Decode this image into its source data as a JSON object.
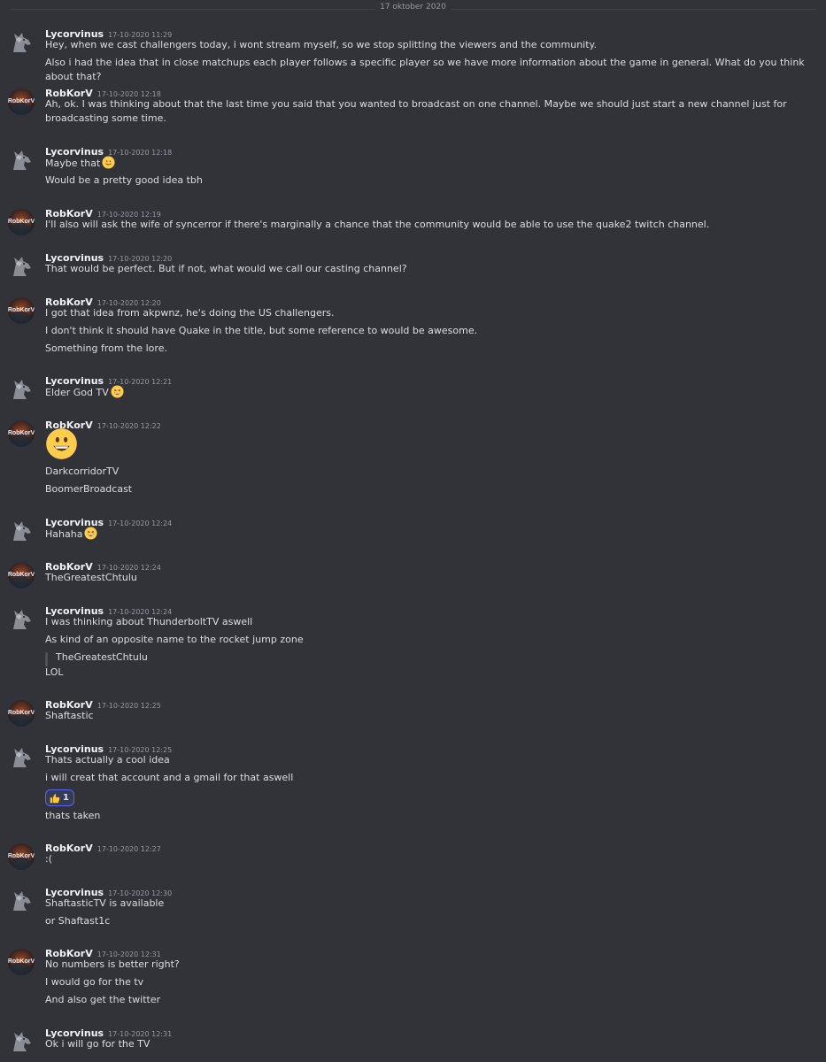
{
  "divider": {
    "date": "17 oktober 2020"
  },
  "users": {
    "lyc": {
      "name": "Lycorvinus"
    },
    "rob": {
      "name": "RobKorV",
      "avatar_text": "RobKorV"
    }
  },
  "groups": [
    {
      "author": "Lycorvinus",
      "time": "17-10-2020 11:29",
      "lines": [
        "Hey, when we cast challengers today, i wont stream myself, so we stop splitting the viewers and the community.",
        "Also i had the idea that in close matchups each player follows a specific player so we have more information about the game in general. What do you think about that?"
      ]
    },
    {
      "author": "RobKorV",
      "time": "17-10-2020 12:18",
      "lines": [
        "Ah, ok. I was thinking about that the last time you said that you wanted to broadcast on one channel. Maybe we should just start a new channel just for broadcasting some time."
      ]
    },
    {
      "author": "Lycorvinus",
      "time": "17-10-2020 12:18",
      "lines": [
        "Maybe that",
        "Would be a pretty good idea tbh"
      ],
      "emoji": "slightly-smiling-face"
    },
    {
      "author": "RobKorV",
      "time": "17-10-2020 12:19",
      "lines": [
        "I'll also will ask the wife of syncerror if there's marginally a chance that the community would be able to use the quake2 twitch channel."
      ]
    },
    {
      "author": "Lycorvinus",
      "time": "17-10-2020 12:20",
      "lines": [
        "That would be perfect. But if not, what would we call our casting channel?"
      ]
    },
    {
      "author": "RobKorV",
      "time": "17-10-2020 12:20",
      "lines": [
        "I got that idea from akpwnz, he's doing the US challengers.",
        "I don't think it should have Quake in the title, but some reference to would be awesome.",
        "Something from the lore."
      ]
    },
    {
      "author": "Lycorvinus",
      "time": "17-10-2020 12:21",
      "lines": [
        "Elder God TV"
      ],
      "emoji": "grinning-squinting-face"
    },
    {
      "author": "RobKorV",
      "time": "17-10-2020 12:22",
      "lines": [
        "DarkcorridorTV",
        "BoomerBroadcast"
      ],
      "big_emoji": "grinning-face"
    },
    {
      "author": "Lycorvinus",
      "time": "17-10-2020 12:24",
      "lines": [
        "Hahaha"
      ],
      "emoji": "grinning-squinting-face"
    },
    {
      "author": "RobKorV",
      "time": "17-10-2020 12:24",
      "lines": [
        "TheGreatestChtulu"
      ]
    },
    {
      "author": "Lycorvinus",
      "time": "17-10-2020 12:24",
      "lines": [
        "I was thinking about ThunderboltTV aswell",
        "As kind of an opposite name to the rocket jump zone"
      ],
      "quote": "TheGreatestChtulu",
      "after_quote": "LOL"
    },
    {
      "author": "RobKorV",
      "time": "17-10-2020 12:25",
      "lines": [
        "Shaftastic"
      ]
    },
    {
      "author": "Lycorvinus",
      "time": "17-10-2020 12:25",
      "lines": [
        "Thats actually a cool idea",
        "i will creat that account and a gmail for that aswell"
      ],
      "reaction": {
        "icon": "thumbs-up",
        "count": "1"
      },
      "after_reaction": "thats taken"
    },
    {
      "author": "RobKorV",
      "time": "17-10-2020 12:27",
      "lines": [
        ":("
      ]
    },
    {
      "author": "Lycorvinus",
      "time": "17-10-2020 12:30",
      "lines": [
        "ShaftasticTV is available",
        "or Shaftast1c"
      ]
    },
    {
      "author": "RobKorV",
      "time": "17-10-2020 12:31",
      "lines": [
        "No numbers is better right?",
        "I would go for the tv",
        "And also get the twitter"
      ]
    },
    {
      "author": "Lycorvinus",
      "time": "17-10-2020 12:31",
      "lines": [
        "Ok i will go for the TV"
      ]
    }
  ]
}
